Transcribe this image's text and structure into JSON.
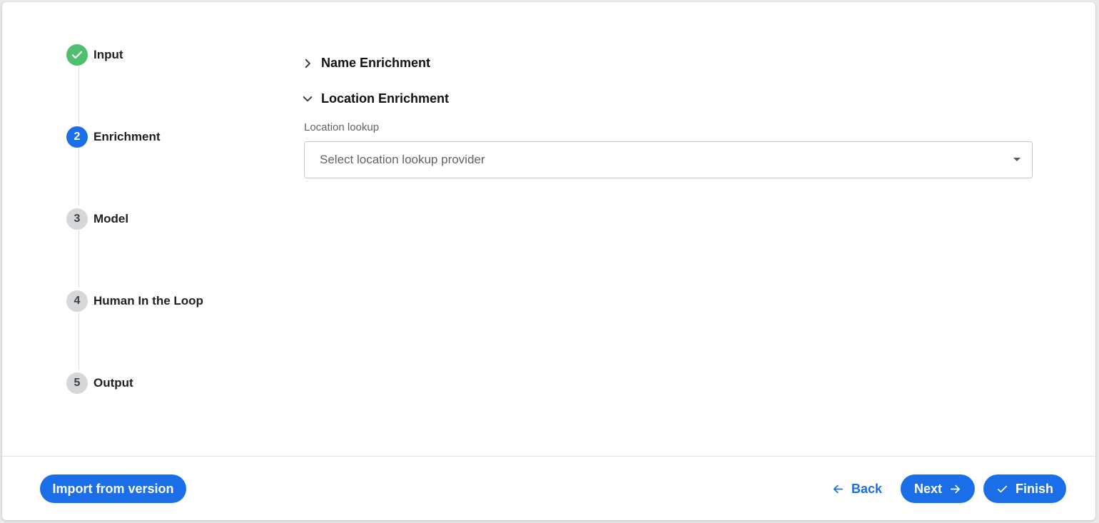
{
  "stepper": {
    "steps": [
      {
        "number": "1",
        "label": "Input",
        "state": "done",
        "icon": "check-icon"
      },
      {
        "number": "2",
        "label": "Enrichment",
        "state": "active"
      },
      {
        "number": "3",
        "label": "Model",
        "state": "pending"
      },
      {
        "number": "4",
        "label": "Human In the Loop",
        "state": "pending"
      },
      {
        "number": "5",
        "label": "Output",
        "state": "pending"
      }
    ]
  },
  "sections": {
    "name_enrichment": {
      "title": "Name Enrichment",
      "expanded": false,
      "icon": "chevron-right-icon"
    },
    "location_enrichment": {
      "title": "Location Enrichment",
      "expanded": true,
      "icon": "chevron-down-icon",
      "location_lookup": {
        "label": "Location lookup",
        "placeholder": "Select location lookup provider",
        "value": ""
      }
    }
  },
  "footer": {
    "import_label": "Import from version",
    "back_label": "Back",
    "next_label": "Next",
    "finish_label": "Finish"
  },
  "colors": {
    "primary": "#1a6fe8",
    "success": "#4fbf6f",
    "pending": "#d6d7d9"
  }
}
